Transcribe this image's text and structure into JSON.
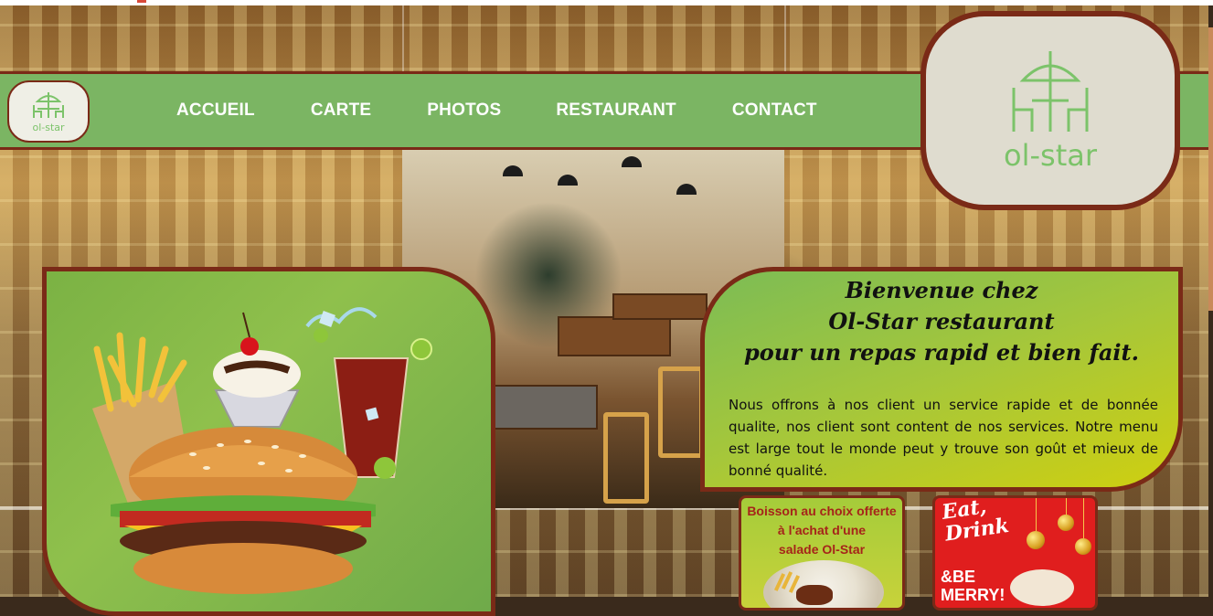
{
  "nav": {
    "items": [
      {
        "label": "ACCUEIL"
      },
      {
        "label": "CARTE"
      },
      {
        "label": "PHOTOS"
      },
      {
        "label": "RESTAURANT"
      },
      {
        "label": "CONTACT"
      }
    ],
    "logo_text": "ol-star"
  },
  "hero_logo": {
    "text": "ol-star"
  },
  "welcome": {
    "title_lines": [
      "Bienvenue chez",
      "Ol-Star restaurant",
      "pour un repas rapid et bien fait."
    ],
    "body": "Nous offrons à nos client un service rapide et de bonnée qualite, nos client sont content de nos services. Notre menu est large tout le monde peut y trouve son goût et mieux de bonné qualité."
  },
  "promos": {
    "drink": {
      "lines": [
        "Boisson au choix offerte",
        "à l'achat d'une",
        "salade Ol-Star"
      ]
    },
    "holiday": {
      "lines": [
        "Eat,",
        "Drink",
        "&BE",
        "MERRY!"
      ]
    }
  },
  "colors": {
    "nav_green": "#7bb563",
    "border_brown": "#7a2a17",
    "logo_green": "#7cc36a",
    "promo_red": "#e01e1e",
    "promo_text_red": "#a6241a"
  },
  "icons": {
    "logo": "umbrella-table-chairs-icon",
    "food": "burger-fries-sundae-drink-image"
  }
}
